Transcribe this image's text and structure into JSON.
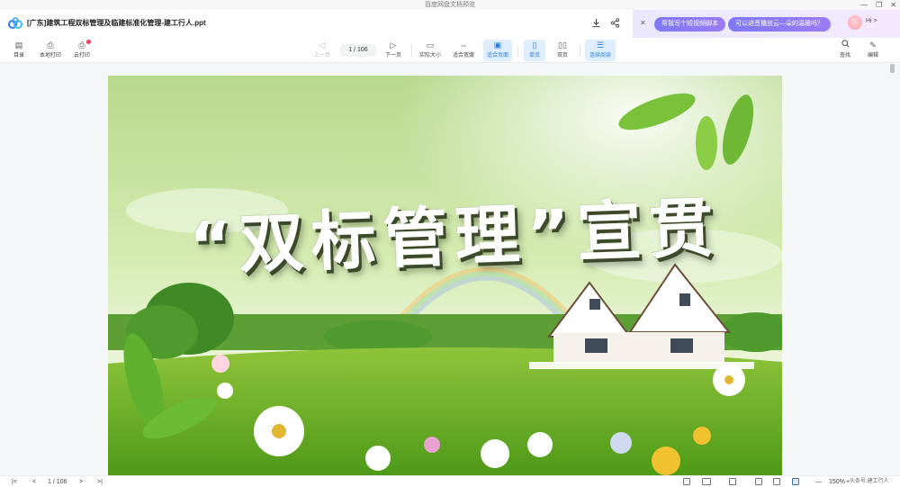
{
  "window": {
    "title": "百度网盘文档预览",
    "controls": [
      "—",
      "❐",
      "✕"
    ]
  },
  "header": {
    "filename": "[广东]建筑工程双标管理及临建标准化管理-建工行人.ppt",
    "download_icon": "download-icon",
    "share_icon": "share-icon"
  },
  "ai_bar": {
    "close_label": "✕",
    "chip1": "帮我写个短视频脚本",
    "chip2": "可以进音播放云—朵的温暖吗？",
    "hi_label": "Hi >"
  },
  "toolbar": {
    "toc": "目录",
    "local_print": "本地打印",
    "cloud_print": "云打印",
    "prev_page": "上一页",
    "page_indicator": "1 / 106",
    "next_page": "下一页",
    "actual_size": "实际大小",
    "fit_width": "适合宽度",
    "fit_page": "适合页面",
    "single_page": "单页",
    "double_page": "双页",
    "continuous": "连续阅读",
    "find": "查找",
    "edit": "编辑"
  },
  "slide": {
    "title": "“双标管理”宣贯"
  },
  "bottombar": {
    "first": "|<",
    "prev": "<",
    "page_indicator": "1 / 106",
    "next": ">",
    "last": ">|",
    "zoom_out": "—",
    "zoom": "150%",
    "zoom_in": "+",
    "watermark": "头条号:建工行人"
  },
  "colors": {
    "accent": "#2a7de1",
    "ai_chip": "#8a7af5",
    "badge": "#f53f5a"
  }
}
